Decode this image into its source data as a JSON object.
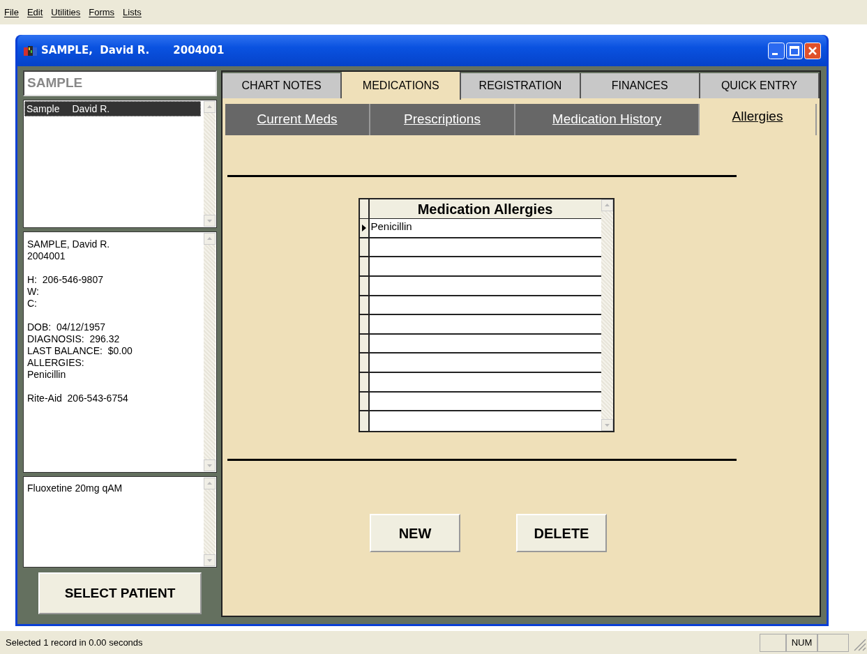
{
  "menu": [
    "File",
    "Edit",
    "Utilities",
    "Forms",
    "Lists"
  ],
  "window": {
    "title_name": "SAMPLE,  David R.",
    "title_id": "2004001"
  },
  "search": {
    "value": "SAMPLE"
  },
  "patients": [
    {
      "last": "Sample",
      "first": "David R.",
      "selected": true
    }
  ],
  "info_blocks": [
    [
      "SAMPLE, David R.",
      "2004001"
    ],
    [
      "H:  206-546-9807",
      "W:",
      "C:"
    ],
    [
      "DOB:  04/12/1957",
      "DIAGNOSIS:  296.32",
      "LAST BALANCE:  $0.00",
      "ALLERGIES:",
      "Penicillin"
    ],
    [
      "Rite-Aid  206-543-6754"
    ]
  ],
  "current_meds": [
    "Fluoxetine 20mg qAM"
  ],
  "select_button": "SELECT PATIENT",
  "tabs": [
    {
      "label": "CHART NOTES",
      "selected": false
    },
    {
      "label": "MEDICATIONS",
      "selected": true
    },
    {
      "label": "REGISTRATION",
      "selected": false
    },
    {
      "label": "FINANCES",
      "selected": false
    },
    {
      "label": "QUICK ENTRY",
      "selected": false
    }
  ],
  "subtabs": [
    {
      "label": "Current Meds",
      "selected": false
    },
    {
      "label": "Prescriptions",
      "selected": false
    },
    {
      "label": "Medication History",
      "selected": false
    },
    {
      "label": "Allergies",
      "selected": true
    }
  ],
  "grid": {
    "column": "Medication Allergies",
    "rows": [
      {
        "allergy": "Penicillin",
        "selected": true
      }
    ]
  },
  "buttons": [
    "NEW",
    "DELETE"
  ],
  "status_bar": {
    "message": "Selected 1 record in 0.00 seconds",
    "indicator": "NUM"
  }
}
